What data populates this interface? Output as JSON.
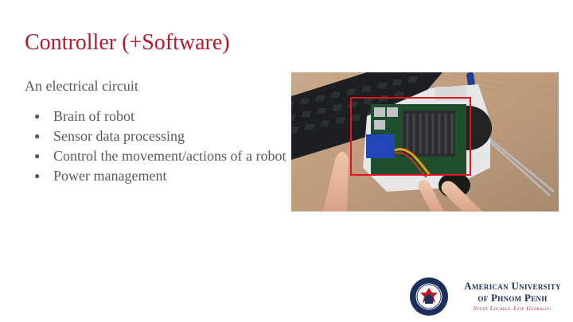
{
  "slide": {
    "title": "Controller (+Software)",
    "subtitle": "An electrical circuit",
    "bullets": [
      "Brain of robot",
      "Sensor data processing",
      "Control the movement/actions of a robot",
      "Power management"
    ],
    "bullet_symbol": "●"
  },
  "logo": {
    "line1": "American University",
    "line2": "of Phnom Penh",
    "tagline": "Study Locally. Live Globally.",
    "seal_text": "American University of Phnom Penh"
  },
  "colors": {
    "title": "#b51b2c",
    "body_text": "#595959",
    "highlight_box": "#e0141e",
    "logo_navy": "#1d2f5c"
  }
}
